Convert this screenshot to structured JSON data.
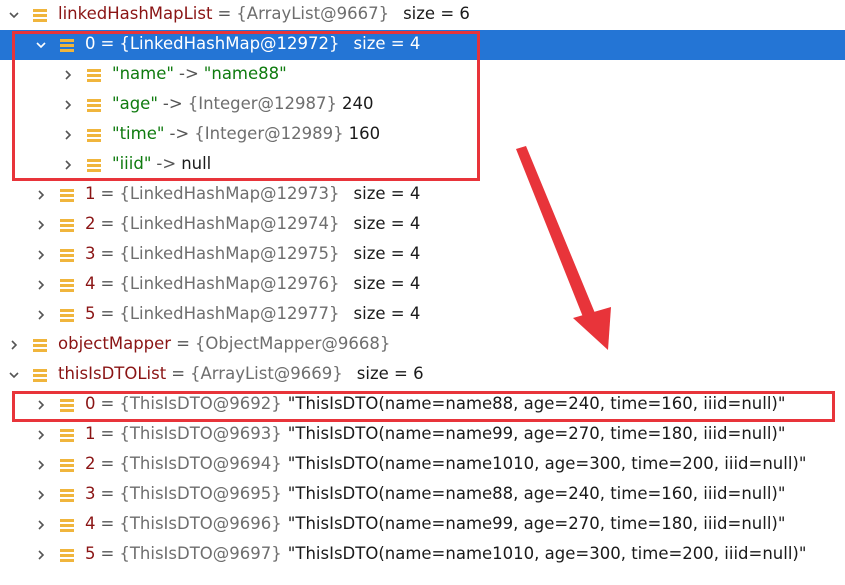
{
  "rows": [
    {
      "indent": 0,
      "expanded": true,
      "name": "linkedHashMapList",
      "type": "{ArrayList@9667}",
      "size_label": "size = 6"
    },
    {
      "indent": 1,
      "expanded": true,
      "selected": true,
      "name": "0",
      "type": "{LinkedHashMap@12972}",
      "size_label": "size = 4"
    },
    {
      "indent": 2,
      "expanded": false,
      "key": "\"name\"",
      "arrow": "->",
      "value": "\"name88\""
    },
    {
      "indent": 2,
      "expanded": false,
      "key": "\"age\"",
      "arrow": "->",
      "type": "{Integer@12987}",
      "value": "240"
    },
    {
      "indent": 2,
      "expanded": false,
      "key": "\"time\"",
      "arrow": "->",
      "type": "{Integer@12989}",
      "value": "160"
    },
    {
      "indent": 2,
      "expanded": false,
      "key": "\"iiid\"",
      "arrow": "->",
      "value": "null"
    },
    {
      "indent": 1,
      "expanded": false,
      "name": "1",
      "type": "{LinkedHashMap@12973}",
      "size_label": "size = 4"
    },
    {
      "indent": 1,
      "expanded": false,
      "name": "2",
      "type": "{LinkedHashMap@12974}",
      "size_label": "size = 4"
    },
    {
      "indent": 1,
      "expanded": false,
      "name": "3",
      "type": "{LinkedHashMap@12975}",
      "size_label": "size = 4"
    },
    {
      "indent": 1,
      "expanded": false,
      "name": "4",
      "type": "{LinkedHashMap@12976}",
      "size_label": "size = 4"
    },
    {
      "indent": 1,
      "expanded": false,
      "name": "5",
      "type": "{LinkedHashMap@12977}",
      "size_label": "size = 4"
    },
    {
      "indent": 0,
      "expanded": false,
      "name": "objectMapper",
      "type": "{ObjectMapper@9668}"
    },
    {
      "indent": 0,
      "expanded": true,
      "name": "thisIsDTOList",
      "type": "{ArrayList@9669}",
      "size_label": "size = 6"
    },
    {
      "indent": 1,
      "expanded": false,
      "name": "0",
      "type": "{ThisIsDTO@9692}",
      "value": "\"ThisIsDTO(name=name88, age=240, time=160, iiid=null)\""
    },
    {
      "indent": 1,
      "expanded": false,
      "name": "1",
      "type": "{ThisIsDTO@9693}",
      "value": "\"ThisIsDTO(name=name99, age=270, time=180, iiid=null)\""
    },
    {
      "indent": 1,
      "expanded": false,
      "name": "2",
      "type": "{ThisIsDTO@9694}",
      "value": "\"ThisIsDTO(name=name1010, age=300, time=200, iiid=null)\""
    },
    {
      "indent": 1,
      "expanded": false,
      "name": "3",
      "type": "{ThisIsDTO@9695}",
      "value": "\"ThisIsDTO(name=name88, age=240, time=160, iiid=null)\""
    },
    {
      "indent": 1,
      "expanded": false,
      "name": "4",
      "type": "{ThisIsDTO@9696}",
      "value": "\"ThisIsDTO(name=name99, age=270, time=180, iiid=null)\""
    },
    {
      "indent": 1,
      "expanded": false,
      "name": "5",
      "type": "{ThisIsDTO@9697}",
      "value": "\"ThisIsDTO(name=name1010, age=300, time=200, iiid=null)\""
    }
  ],
  "colors": {
    "selection": "#2475d5",
    "highlight": "#e8343a",
    "field_icon": "#f0b53c",
    "name": "#8a1414",
    "string": "#0f7b0f",
    "type": "#6e6e6e"
  },
  "icons": {
    "expand": "chevron-right-icon",
    "collapse": "chevron-down-icon",
    "field": "field-icon"
  }
}
